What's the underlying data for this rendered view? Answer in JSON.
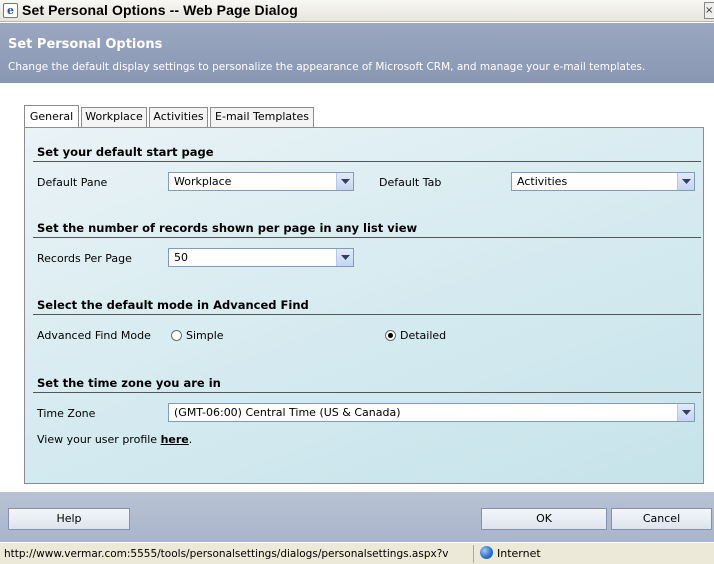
{
  "window": {
    "title": "Set Personal Options -- Web Page Dialog",
    "close_label": "×"
  },
  "header": {
    "title": "Set Personal Options",
    "description": "Change the default display settings to personalize the appearance of Microsoft CRM, and manage your e-mail templates."
  },
  "tabs": [
    {
      "label": "General",
      "active": true
    },
    {
      "label": "Workplace",
      "active": false
    },
    {
      "label": "Activities",
      "active": false
    },
    {
      "label": "E-mail Templates",
      "active": false
    }
  ],
  "sections": {
    "start_page": {
      "title": "Set your default start page",
      "default_pane_label": "Default Pane",
      "default_pane_value": "Workplace",
      "default_tab_label": "Default Tab",
      "default_tab_value": "Activities"
    },
    "records": {
      "title": "Set the number of records shown per page in any list view",
      "records_label": "Records Per Page",
      "records_value": "50"
    },
    "advanced_find": {
      "title": "Select the default mode in Advanced Find",
      "mode_label": "Advanced Find Mode",
      "option_simple": "Simple",
      "option_detailed": "Detailed",
      "selected": "Detailed"
    },
    "time_zone": {
      "title": "Set the time zone you are in",
      "tz_label": "Time Zone",
      "tz_value": "(GMT-06:00) Central Time (US & Canada)",
      "profile_text": "View your user profile",
      "profile_link": "here",
      "profile_suffix": "."
    }
  },
  "footer": {
    "help_label": "Help",
    "ok_label": "OK",
    "cancel_label": "Cancel"
  },
  "statusbar": {
    "url": "http://www.vermar.com:5555/tools/personalsettings/dialogs/personalsettings.aspx?v",
    "zone": "Internet"
  }
}
